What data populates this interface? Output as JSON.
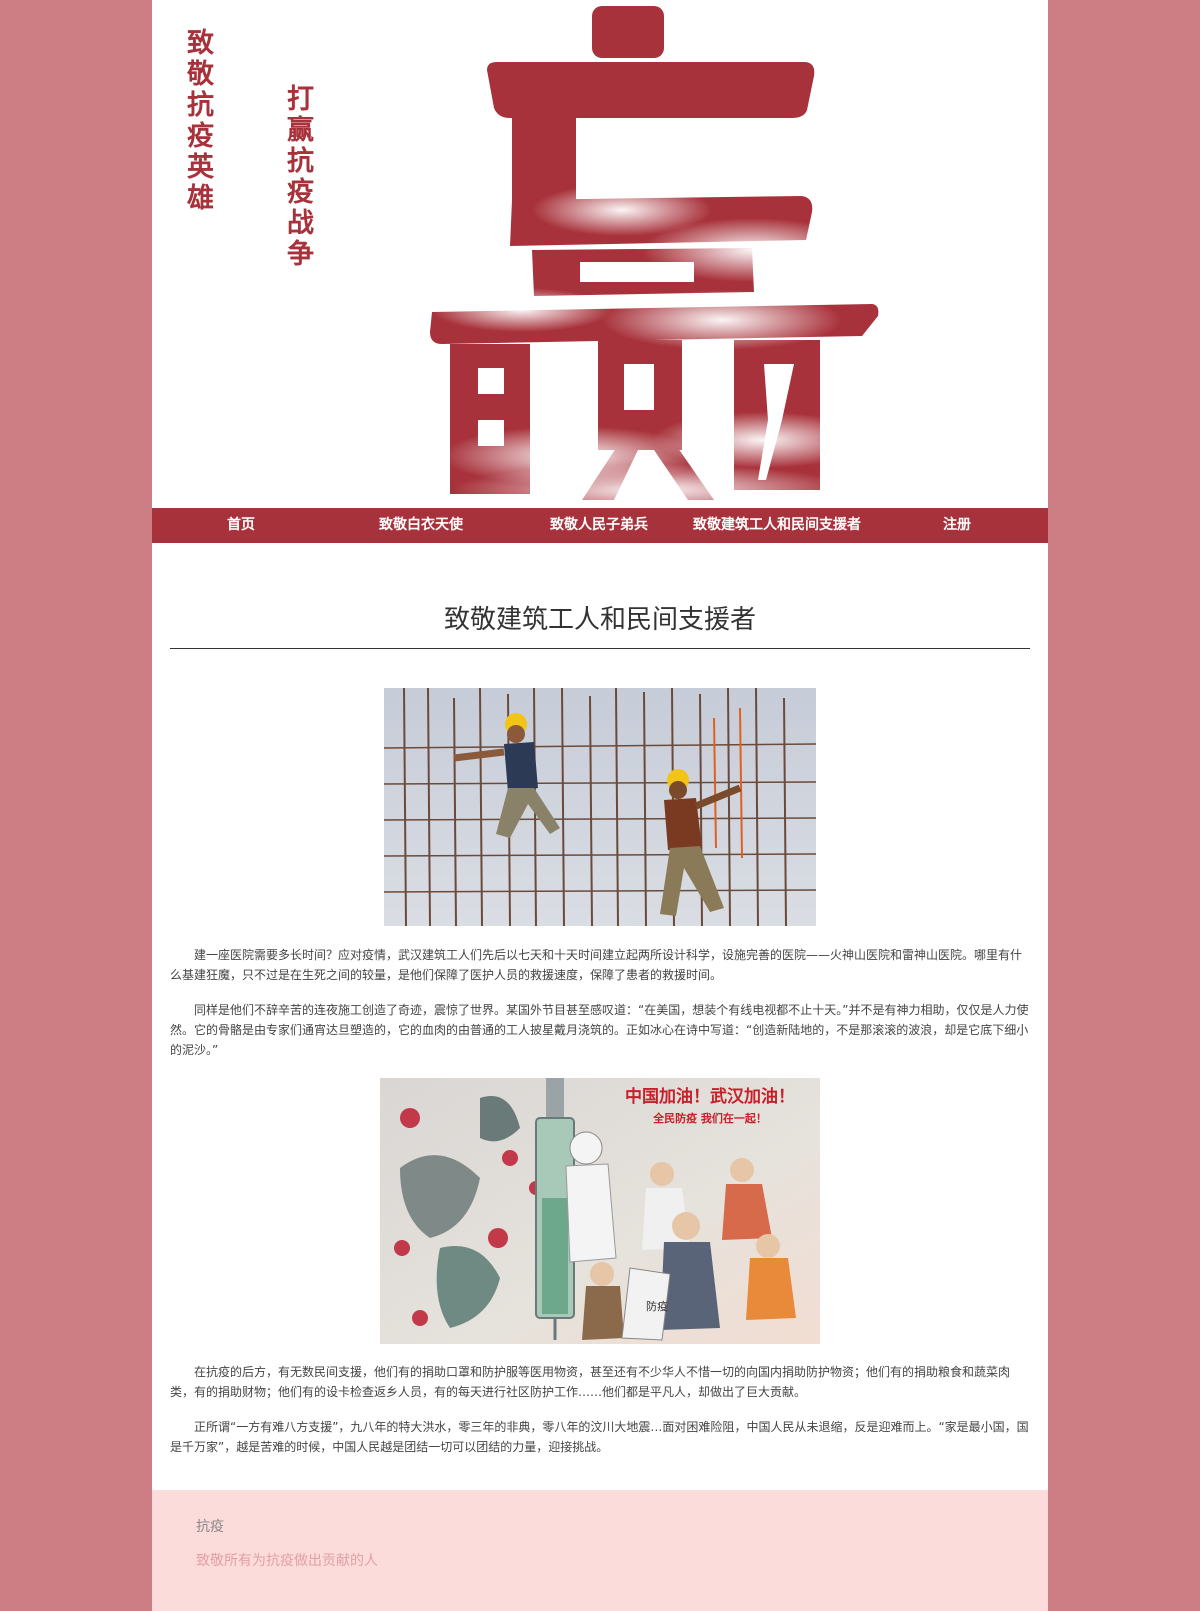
{
  "banner": {
    "slogan_left": "致敬抗疫英雄",
    "slogan_right": "打赢抗疫战争",
    "big_character": "赢"
  },
  "nav": {
    "items": [
      "首页",
      "致敬白衣天使",
      "致敬人民子弟兵",
      "致敬建筑工人和民间支援者",
      "注册"
    ]
  },
  "article": {
    "title": "致敬建筑工人和民间支援者",
    "paragraphs": [
      "建一座医院需要多长时间？应对疫情，武汉建筑工人们先后以七天和十天时间建立起两所设计科学，设施完善的医院——火神山医院和雷神山医院。哪里有什么基建狂魔，只不过是在生死之间的较量，是他们保障了医护人员的救援速度，保障了患者的救援时间。",
      "同样是他们不辞辛苦的连夜施工创造了奇迹，震惊了世界。某国外节目甚至感叹道：“在美国，想装个有线电视都不止十天。”并不是有神力相助，仅仅是人力使然。它的骨骼是由专家们通宵达旦塑造的，它的血肉的由普通的工人披星戴月浇筑的。正如冰心在诗中写道：“创造新陆地的，不是那滚滚的波浪，却是它底下细小的泥沙。”",
      "在抗疫的后方，有无数民间支援，他们有的捐助口罩和防护服等医用物资，甚至还有不少华人不惜一切的向国内捐助防护物资；他们有的捐助粮食和蔬菜肉类，有的捐助财物；他们有的设卡检查返乡人员，有的每天进行社区防护工作……他们都是平凡人，却做出了巨大贡献。",
      "正所谓“一方有难八方支援”，九八年的特大洪水，零三年的非典，零八年的汶川大地震…面对困难险阻，中国人民从未退缩，反是迎难而上。“家是最小国，国是千万家”，越是苦难的时候，中国人民越是团结一切可以团结的力量，迎接挑战。"
    ],
    "image2_caption_1": "中国加油！武汉加油！",
    "image2_caption_2": "全民防疫 我们在一起！",
    "image2_shield_text": "防疫"
  },
  "footer": {
    "title": "抗疫",
    "subtitle": "致敬所有为抗疫做出贡献的人"
  },
  "colors": {
    "background": "#cd7e84",
    "accent": "#a8323b",
    "footer_bg": "#fcdcda"
  }
}
